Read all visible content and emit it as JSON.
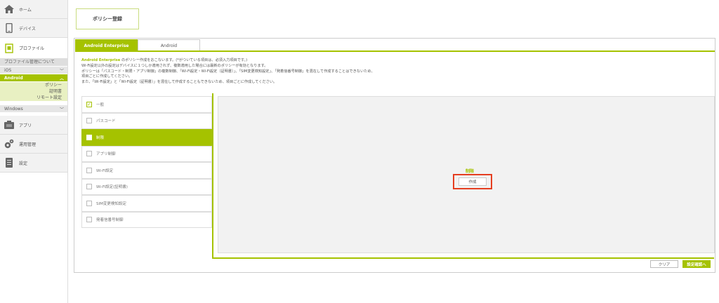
{
  "sidebar": {
    "home": {
      "label": "ホーム",
      "icon": "home-icon"
    },
    "device": {
      "label": "デバイス",
      "icon": "phone-icon"
    },
    "profile": {
      "label": "プロファイル",
      "icon": "profile-icon"
    },
    "profile_about": "プロファイル管理について",
    "ios": "iOS",
    "android": {
      "label": "Android",
      "items": [
        "ポリシー",
        "証明書",
        "リモート設定"
      ]
    },
    "windows": "Windows",
    "apps": {
      "label": "アプリ",
      "icon": "apps-icon"
    },
    "ops": {
      "label": "運用管理",
      "icon": "gear-icon"
    },
    "settings": {
      "label": "設定",
      "icon": "settings-icon"
    }
  },
  "page": {
    "title": "ポリシー登録"
  },
  "tabs": [
    {
      "label": "Android Enterprise",
      "active": true
    },
    {
      "label": "Android",
      "active": false
    }
  ],
  "notes": {
    "line1_brand": "Android Enterprise",
    "line1_rest": " のポリシー作成をおこないます。(*がついている項目は、必須入力項目です。)",
    "line2": "Wi-Fi設定以外の設定はデバイスに１つしか適用されず、複数適用した場合には最新のポリシーが有効となります。",
    "line3": "ポリシーは「パスコード・制限・アプリ制御」の複数制御、「Wi-Fi設定・Wi-Fi設定（証明書）」、「SIM変更検知設定」、「発着信番号制御」を混在して作成することはできないため、",
    "line4": "項目ごとに作成してください。",
    "line5": "また、「Wi-Fi設定」と「Wi-Fi設定（証明書）」を混在して作成することもできないため、項目ごとに作成してください。"
  },
  "policy_items": [
    {
      "label": "一般",
      "checked": true,
      "selected": false
    },
    {
      "label": "パスコード",
      "checked": false,
      "selected": false
    },
    {
      "label": "制限",
      "checked": false,
      "selected": true
    },
    {
      "label": "アプリ制御",
      "checked": false,
      "selected": false
    },
    {
      "label": "Wi-Fi設定",
      "checked": false,
      "selected": false
    },
    {
      "label": "Wi-Fi設定(証明書)",
      "checked": false,
      "selected": false
    },
    {
      "label": "SIM変更検知設定",
      "checked": false,
      "selected": false
    },
    {
      "label": "発着信番号制御",
      "checked": false,
      "selected": false
    }
  ],
  "detail": {
    "section_label": "制限",
    "create_button": "作成"
  },
  "actions": {
    "clear": "クリア",
    "confirm": "設定確認へ"
  },
  "colors": {
    "accent": "#a5c200",
    "highlight": "#e53e20"
  }
}
